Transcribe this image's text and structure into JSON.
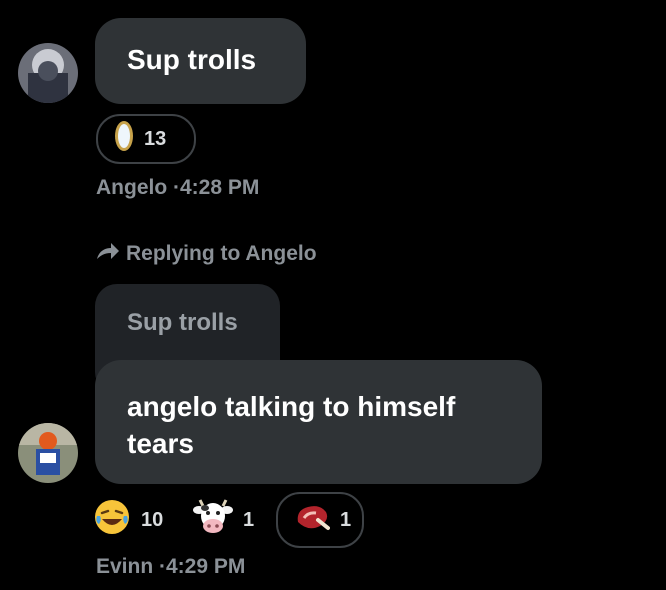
{
  "messages": [
    {
      "author": "Angelo",
      "text": "Sup trolls",
      "reactions": [
        {
          "icon": "mirror-icon",
          "count": "13"
        }
      ],
      "meta": "Angelo ·4:28 PM"
    },
    {
      "author": "Evinn",
      "reply_to_label": "Replying to Angelo",
      "quoted_text": "Sup trolls",
      "text": "angelo talking to himself tears",
      "reactions": [
        {
          "icon": "laughing-emoji-icon",
          "count": "10"
        },
        {
          "icon": "cow-emoji-icon",
          "count": "1"
        },
        {
          "icon": "steak-emoji-icon",
          "count": "1"
        }
      ],
      "meta": "Evinn ·4:29 PM"
    }
  ],
  "colors": {
    "background": "#000000",
    "bubble": "#2f3336",
    "quote_bubble": "#202327",
    "meta_text": "#8b9197"
  }
}
